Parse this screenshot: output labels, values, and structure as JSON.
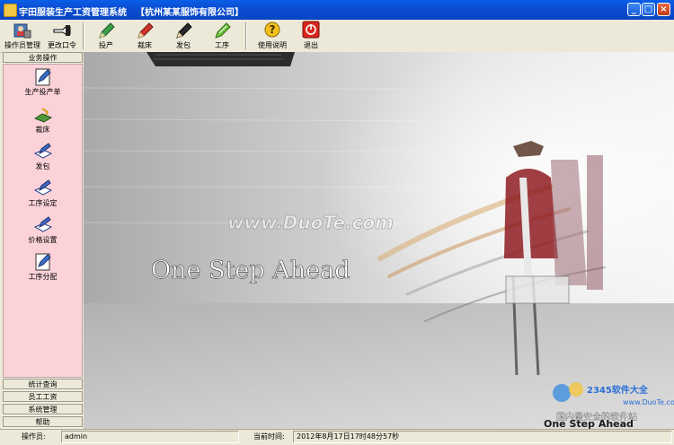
{
  "window": {
    "title": "宇田服装生产工资管理系统",
    "company": "【杭州某某服饰有限公司】"
  },
  "toolbar": {
    "items": [
      {
        "label": "操作员管理",
        "icon": "users-icon"
      },
      {
        "label": "更改口令",
        "icon": "key-hand-icon"
      },
      {
        "label": "投产",
        "icon": "pen-green-icon"
      },
      {
        "label": "裁床",
        "icon": "pen-red-icon"
      },
      {
        "label": "发包",
        "icon": "pen-black-icon"
      },
      {
        "label": "工序",
        "icon": "pen-leaf-icon"
      },
      {
        "label": "使用说明",
        "icon": "help-icon"
      },
      {
        "label": "退出",
        "icon": "exit-icon"
      }
    ]
  },
  "sidebar": {
    "header": "业务操作",
    "items": [
      {
        "label": "生产投产单",
        "icon": "document-pen-icon"
      },
      {
        "label": "裁床",
        "icon": "cutting-icon"
      },
      {
        "label": "发包",
        "icon": "package-pen-icon"
      },
      {
        "label": "工序设定",
        "icon": "process-pen-icon"
      },
      {
        "label": "价格设置",
        "icon": "price-pen-icon"
      },
      {
        "label": "工序分配",
        "icon": "assign-pen-icon"
      }
    ],
    "bottom_headers": [
      "统计查询",
      "员工工资",
      "系统管理",
      "帮助"
    ]
  },
  "banner": {
    "slogan": "One Step Ahead",
    "watermark": "www.DuoTe.com",
    "corner_slogan": "One Step Ahead",
    "corner_brand": "2345软件大全",
    "corner_sub": "国内最安全的软件站",
    "corner_url": "www.DuoTe.com"
  },
  "status": {
    "operator_label": "操作员:",
    "operator_value": "admin",
    "time_label": "当前时间:",
    "time_value": "2012年8月17日17时48分57秒"
  }
}
